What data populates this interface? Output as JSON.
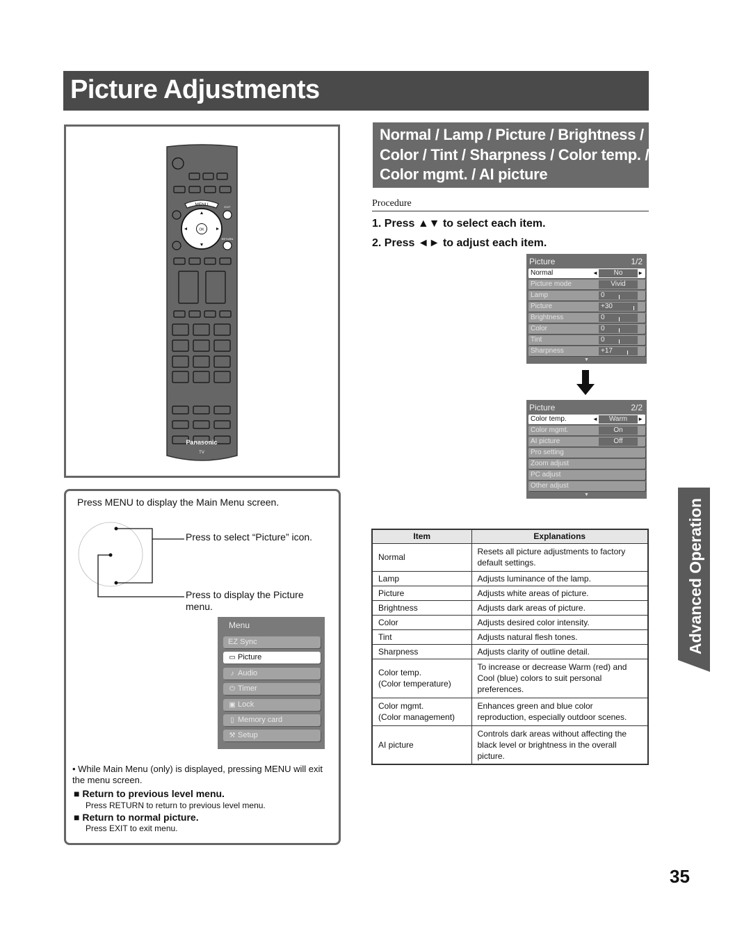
{
  "page": {
    "title": "Picture Adjustments",
    "page_number": "35",
    "side_tab": "Advanced Operation"
  },
  "section": {
    "heading_lines": [
      "Normal / Lamp / Picture / Brightness /",
      "Color / Tint / Sharpness / Color temp. /",
      "Color mgmt. / AI picture"
    ],
    "procedure_label": "Procedure",
    "steps": [
      "1.  Press ▲▼ to select each item.",
      "2.  Press ◄► to adjust each item."
    ]
  },
  "remote": {
    "brand": "Panasonic",
    "model_label": "TV",
    "menu_label": "MENU",
    "exit_label": "EXIT",
    "return_label": "RETURN",
    "ok_label": "OK"
  },
  "menu_box": {
    "instruction": "Press MENU to display the Main Menu screen.",
    "select_note": "Press to select “Picture” icon.",
    "display_note": "Press to display the Picture menu.",
    "main_menu": {
      "title": "Menu",
      "items": [
        {
          "label": "EZ Sync",
          "icon": "",
          "selected": false
        },
        {
          "label": "Picture",
          "icon": "▭",
          "selected": true
        },
        {
          "label": "Audio",
          "icon": "♪",
          "selected": false
        },
        {
          "label": "Timer",
          "icon": "⏻",
          "selected": false
        },
        {
          "label": "Lock",
          "icon": "▣",
          "selected": false
        },
        {
          "label": "Memory card",
          "icon": "▯",
          "selected": false
        },
        {
          "label": "Setup",
          "icon": "⚒",
          "selected": false
        }
      ]
    },
    "bullet_note": "•  While Main Menu (only) is displayed, pressing MENU will exit the menu screen.",
    "return_prev_heading": "■  Return to previous level menu.",
    "return_prev_text": "Press RETURN to return to previous level menu.",
    "return_normal_heading": "■  Return to normal picture.",
    "return_normal_text": "Press EXIT to exit menu."
  },
  "osd_page1": {
    "title": "Picture",
    "page": "1/2",
    "rows": [
      {
        "label": "Normal",
        "value": "No",
        "selected": true,
        "arrows": true,
        "slider": null
      },
      {
        "label": "Picture mode",
        "value": "Vivid",
        "selected": false,
        "arrows": false,
        "slider": null
      },
      {
        "label": "Lamp",
        "value": "0",
        "selected": false,
        "arrows": false,
        "slider": 0.5
      },
      {
        "label": "Picture",
        "value": "+30",
        "selected": false,
        "arrows": false,
        "slider": 0.95
      },
      {
        "label": "Brightness",
        "value": "0",
        "selected": false,
        "arrows": false,
        "slider": 0.5
      },
      {
        "label": "Color",
        "value": "0",
        "selected": false,
        "arrows": false,
        "slider": 0.5
      },
      {
        "label": "Tint",
        "value": "0",
        "selected": false,
        "arrows": false,
        "slider": 0.5
      },
      {
        "label": "Sharpness",
        "value": "+17",
        "selected": false,
        "arrows": false,
        "slider": 0.77
      }
    ]
  },
  "osd_page2": {
    "title": "Picture",
    "page": "2/2",
    "rows": [
      {
        "label": "Color temp.",
        "value": "Warm",
        "selected": true,
        "arrows": true
      },
      {
        "label": "Color mgmt.",
        "value": "On",
        "selected": false,
        "arrows": false
      },
      {
        "label": "AI picture",
        "value": "Off",
        "selected": false,
        "arrows": false
      },
      {
        "label": "Pro setting",
        "value": null,
        "selected": false,
        "arrows": false
      },
      {
        "label": "Zoom adjust",
        "value": null,
        "selected": false,
        "arrows": false
      },
      {
        "label": "PC adjust",
        "value": null,
        "selected": false,
        "arrows": false
      },
      {
        "label": "Other adjust",
        "value": null,
        "selected": false,
        "arrows": false
      }
    ]
  },
  "table": {
    "headers": [
      "Item",
      "Explanations"
    ],
    "rows": [
      {
        "item": "Normal",
        "explanation": "Resets all picture adjustments to factory default settings."
      },
      {
        "item": "Lamp",
        "explanation": "Adjusts luminance of the lamp."
      },
      {
        "item": "Picture",
        "explanation": "Adjusts white areas of picture."
      },
      {
        "item": "Brightness",
        "explanation": "Adjusts dark areas of picture."
      },
      {
        "item": "Color",
        "explanation": "Adjusts desired color intensity."
      },
      {
        "item": "Tint",
        "explanation": "Adjusts natural flesh tones."
      },
      {
        "item": "Sharpness",
        "explanation": "Adjusts clarity of outline detail."
      },
      {
        "item": "Color temp.\n(Color temperature)",
        "explanation": "To increase or decrease Warm (red) and Cool (blue) colors to suit personal preferences."
      },
      {
        "item": "Color mgmt.\n(Color management)",
        "explanation": "Enhances green and blue color reproduction, especially outdoor scenes."
      },
      {
        "item": "AI picture",
        "explanation": "Controls dark areas without affecting the black level or brightness in the overall picture."
      }
    ]
  }
}
